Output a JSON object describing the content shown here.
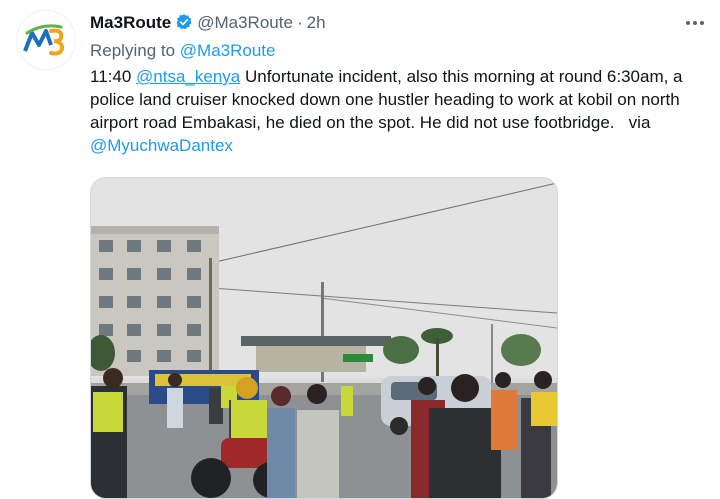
{
  "author": {
    "display_name": "Ma3Route",
    "handle": "@Ma3Route",
    "time": "2h",
    "separator": "·",
    "avatar_icon": "ma3route-logo",
    "verified_icon": "verified-badge-icon"
  },
  "reply": {
    "prefix": "Replying to",
    "target": "@Ma3Route"
  },
  "tweet": {
    "time_label": "11:40",
    "mention": "@ntsa_kenya",
    "body": "Unfortunate incident, also this morning at round 6:30am, a police land cruiser knocked down one hustler heading to work at kobil on north airport road Embakasi, he died on the spot. He did not use footbridge.",
    "via_label": "via",
    "via_handle": "@MyuchwaDantex"
  },
  "media": {
    "kind": "photo",
    "subject": "street accident scene"
  },
  "colors": {
    "link": "#1d9bf0",
    "muted": "#536471",
    "text": "#0f1419",
    "verified": "#1d9bf0"
  },
  "menu_icon": "more-options-icon"
}
